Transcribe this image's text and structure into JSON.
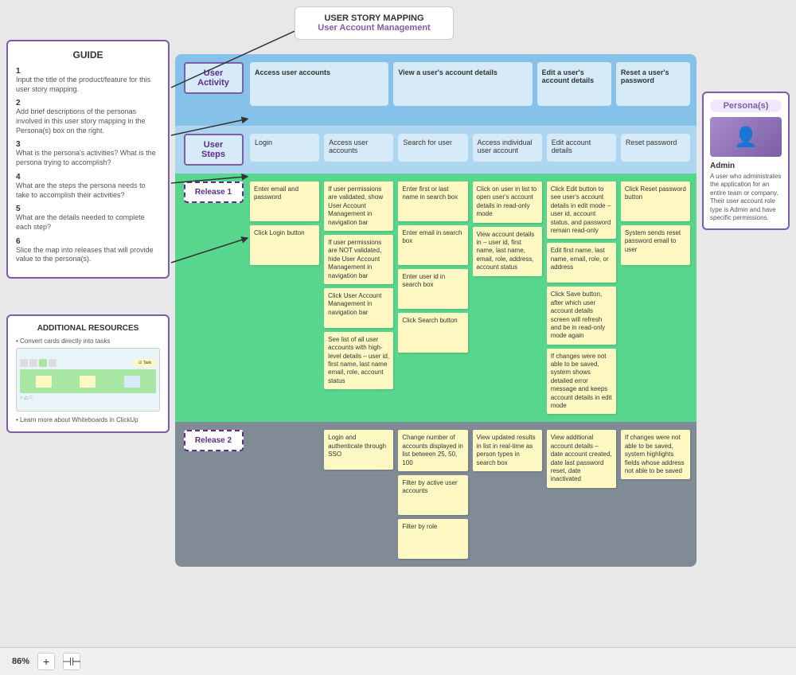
{
  "header": {
    "title": "USER STORY MAPPING",
    "subtitle": "User Account Management"
  },
  "guide": {
    "title": "GUIDE",
    "items": [
      {
        "num": "1",
        "text": "Input the title of the product/feature for this user story mapping."
      },
      {
        "num": "2",
        "text": "Add brief descriptions of the personas involved in this user story mapping in the Persona(s) box on the right."
      },
      {
        "num": "3",
        "text": "What is the persona's activities? What is the persona trying to accomplish?"
      },
      {
        "num": "4",
        "text": "What are the steps the persona needs to take to accomplish their activities?"
      },
      {
        "num": "5",
        "text": "What are the details needed to complete each step?"
      },
      {
        "num": "6",
        "text": "Slice the map into releases that will provide value to the persona(s)."
      }
    ]
  },
  "resources": {
    "title": "ADDITIONAL RESOURCES",
    "convert_text": "• Convert cards directly into tasks",
    "learn_text": "• Learn more about Whiteboards in ClickUp"
  },
  "persona": {
    "title": "Persona(s)",
    "name": "Admin",
    "description": "A user who administrates the application for an entire team or company. Their user account role type is Admin and have specific permissions."
  },
  "labels": {
    "user_activity": "User Activity",
    "user_steps": "User Steps",
    "release1": "Release 1",
    "release2": "Release 2"
  },
  "activities": [
    {
      "text": "Access user accounts"
    },
    {
      "text": "View a user's account details"
    },
    {
      "text": "Edit a user's account details"
    },
    {
      "text": "Reset a user's password"
    }
  ],
  "steps": [
    {
      "text": "Login"
    },
    {
      "text": "Access user accounts"
    },
    {
      "text": "Search for user"
    },
    {
      "text": "Access individual user account"
    },
    {
      "text": "Edit account details"
    },
    {
      "text": "Reset password"
    }
  ],
  "release1_notes": [
    [
      {
        "text": "Enter email and password"
      },
      {
        "text": "Click Login button"
      }
    ],
    [
      {
        "text": "If user permissions are validated, show User Account Management in navigation bar"
      },
      {
        "text": "If user permissions are NOT validated, hide User Account Management in navigation bar"
      },
      {
        "text": "Click User Account Management in navigation bar"
      },
      {
        "text": "See list of all user accounts with high-level details – user id, first name, last name email, role, account status"
      }
    ],
    [
      {
        "text": "Enter first or last name in search box"
      },
      {
        "text": "Enter email in search box"
      },
      {
        "text": "Enter user id in search box"
      },
      {
        "text": "Click Search button"
      }
    ],
    [
      {
        "text": "Click on user in list to open user's account details in read-only mode"
      },
      {
        "text": "View account details in – user id, first name, last name, email, role, address, account status"
      }
    ],
    [
      {
        "text": "Click Edit button to see user's account details in edit mode – user id, account status, and password remain read-only"
      },
      {
        "text": "Edit first name, last name, email, role, or address"
      },
      {
        "text": "Click Save button, after which user account details screen will refresh and be in read-only mode again"
      },
      {
        "text": "If changes were not able to be saved, system shows detailed error message and keeps account details in edit mode"
      }
    ],
    [
      {
        "text": "Click Reset password button"
      },
      {
        "text": "System sends reset password email to user"
      }
    ]
  ],
  "release2_notes": [
    [
      {
        "text": "Login and authenticate through SSO"
      }
    ],
    [
      {
        "text": "Change number of accounts displayed in list between 25, 50, 100"
      },
      {
        "text": "Filter by active user accounts"
      },
      {
        "text": "Filter by role"
      }
    ],
    [
      {
        "text": "View updated results in list in real-time as person types in search box"
      }
    ],
    [
      {
        "text": "View additional account details – date account created, date last password reset, date inactivated"
      }
    ],
    [
      {
        "text": "If changes were not able to be saved, system highlights fields whose address not able to be saved"
      }
    ]
  ],
  "toolbar": {
    "zoom": "86%",
    "plus_label": "+",
    "fit_label": "⊣⊢"
  }
}
